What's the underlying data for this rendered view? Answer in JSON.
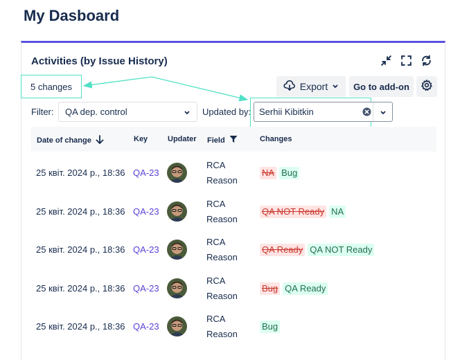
{
  "page": {
    "title": "My Dasboard"
  },
  "widget": {
    "title": "Activities (by Issue History)",
    "change_count": "5 changes",
    "accent_color": "#5a52e0",
    "highlight_color": "#4fe0c5",
    "actions": [
      "collapse-icon",
      "fullscreen-icon",
      "refresh-icon"
    ],
    "export_label": "Export",
    "addon_label": "Go to add-on"
  },
  "filters": {
    "filter_label": "Filter:",
    "filter_value": "QA dep. control",
    "updated_by_label": "Updated by:",
    "updated_by_value": "Serhii Kibitkin"
  },
  "table": {
    "columns": [
      "Date of change",
      "Key",
      "Updater",
      "Field",
      "Changes"
    ],
    "rows": [
      {
        "date": "25 квіт. 2024 р., 18:36",
        "key": "QA-23",
        "field_line1": "RCA",
        "field_line2": "Reason",
        "old": "NA",
        "new": "Bug"
      },
      {
        "date": "25 квіт. 2024 р., 18:36",
        "key": "QA-23",
        "field_line1": "RCA",
        "field_line2": "Reason",
        "old": "QA NOT Ready",
        "new": "NA"
      },
      {
        "date": "25 квіт. 2024 р., 18:36",
        "key": "QA-23",
        "field_line1": "RCA",
        "field_line2": "Reason",
        "old": "QA Ready",
        "new": "QA NOT Ready"
      },
      {
        "date": "25 квіт. 2024 р., 18:36",
        "key": "QA-23",
        "field_line1": "RCA",
        "field_line2": "Reason",
        "old": "Bug",
        "new": "QA Ready"
      },
      {
        "date": "25 квіт. 2024 р., 18:36",
        "key": "QA-23",
        "field_line1": "RCA",
        "field_line2": "Reason",
        "old": "",
        "new": "Bug"
      }
    ]
  }
}
